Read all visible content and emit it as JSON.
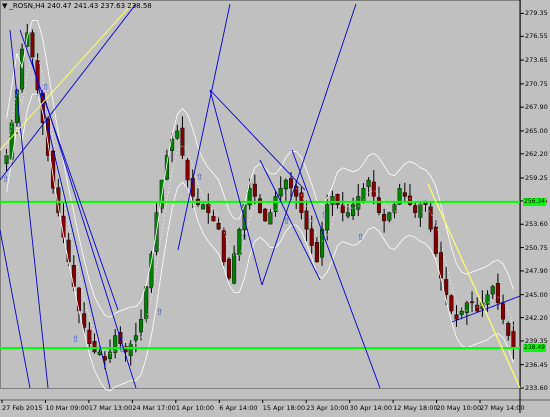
{
  "header": {
    "symbol_line": "_ROSN,H4  240.47 241.43 237.63 238.58"
  },
  "price_axis": {
    "ticks": [
      "279.35",
      "276.55",
      "273.65",
      "270.75",
      "267.90",
      "265.00",
      "262.20",
      "259.25",
      "256.45",
      "253.60",
      "250.75",
      "247.90",
      "245.00",
      "242.20",
      "239.35",
      "236.45",
      "233.60"
    ],
    "labels": [
      {
        "value": "256.34",
        "color": "#00ff00"
      },
      {
        "value": "238.49",
        "color": "#00ff00"
      }
    ]
  },
  "time_axis": {
    "ticks": [
      "27 Feb 2015",
      "10 Mar 09:00",
      "17 Mar 13:00",
      "24 Mar 17:00",
      "1 Apr 10:00",
      "6 Apr 14:00",
      "15 Apr 18:00",
      "23 Apr 10:00",
      "30 Apr 14:00",
      "12 May 18:00",
      "20 May 10:00",
      "27 May 14:00"
    ]
  },
  "colors": {
    "background": "#c0c0c0",
    "bull_candle": "#008000",
    "bear_candle": "#800000",
    "support_resistance": "#00ff00",
    "trendline": "#0000cc",
    "channel_line": "#ffff66",
    "bollinger": "#ffffff"
  },
  "chart_data": {
    "type": "candlestick",
    "symbol": "_ROSN",
    "timeframe": "H4",
    "last_bar": {
      "open": 240.47,
      "high": 241.43,
      "low": 237.63,
      "close": 238.58
    },
    "ylim": [
      233.6,
      280.5
    ],
    "horizontal_levels": [
      256.34,
      238.49
    ],
    "closes": [
      262,
      266,
      270,
      275,
      277,
      274,
      270,
      266,
      262,
      258,
      255,
      252,
      249,
      246,
      243,
      241,
      239,
      238,
      238,
      237,
      238,
      240,
      239,
      238,
      239,
      240,
      242,
      246,
      250,
      255,
      259,
      262,
      264,
      265,
      262,
      259,
      257,
      256,
      256,
      255,
      254,
      253,
      249,
      247,
      250,
      253,
      256,
      258,
      257,
      255,
      254,
      255,
      257,
      258,
      259,
      258,
      257,
      255,
      253,
      251,
      249,
      253,
      256,
      257,
      256,
      255,
      255,
      256,
      257,
      258,
      259,
      257,
      255,
      254,
      255,
      256,
      258,
      257,
      256,
      255,
      256,
      256,
      253,
      250,
      247,
      245,
      243,
      242,
      243,
      244,
      244,
      243,
      244,
      245,
      246,
      244,
      242,
      240,
      238.58
    ]
  }
}
